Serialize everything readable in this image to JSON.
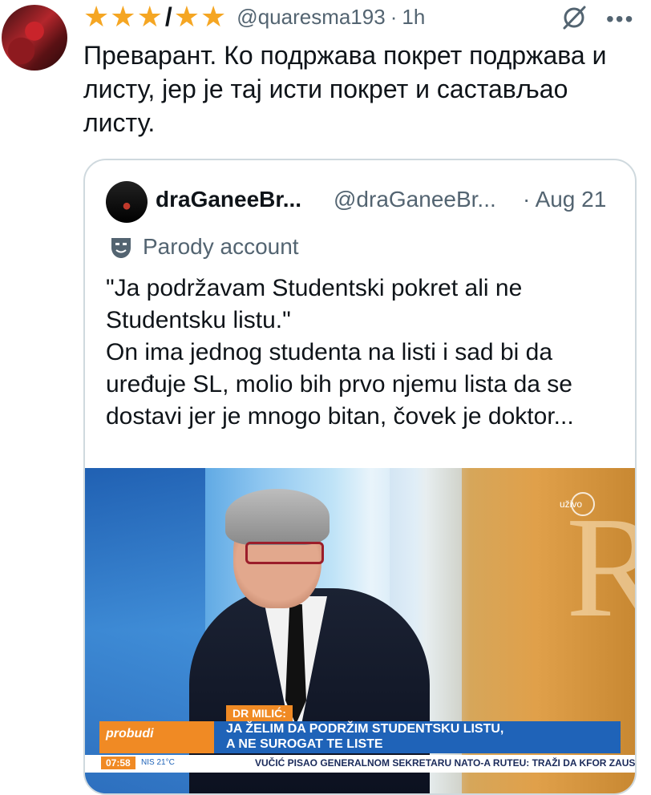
{
  "tweet": {
    "stars": [
      "★",
      "★",
      "★"
    ],
    "slash": "/",
    "stars2": [
      "★",
      "★"
    ],
    "handle": "@quaresma193",
    "separator": "·",
    "time": "1h",
    "text": "Преварант. Ко подржава покрет подржава и листу, јер је тај исти покрет и састављао листу."
  },
  "quote": {
    "display_name": "draGaneeBr...",
    "handle": "@draGaneeBr...",
    "separator": "·",
    "date": "Aug 21",
    "parody_label": "Parody account",
    "text_line1": "\"Ja podržavam Studentski pokret ali ne Studentsku listu.\"",
    "text_line2": "On ima jednog studenta na listi i sad bi da uređuje SL, molio bih prvo njemu lista da se dostavi jer je mnogo bitan, čovek je doktor...",
    "image": {
      "live_label": "uživo",
      "speaker_tag": "DR MILIĆ:",
      "brand": "probudi",
      "headline_line1": "JA ŽELIM DA PODRŽIM STUDENTSKU LISTU,",
      "headline_line2": "A NE SUROGAT TE LISTE",
      "ticker_time": "07:58",
      "ticker_meta": "NIS      21°C",
      "ticker_text": "VUČIĆ PISAO GENERALNOM SEKRETARU NATO-A RUTEU: TRAŽI DA KFOR ZAUSTAV"
    }
  },
  "colors": {
    "star": "#f5a623",
    "secondary_text": "#536471",
    "border": "#cfd9de",
    "accent_orange": "#f08a24",
    "accent_blue": "#1f63b8"
  }
}
